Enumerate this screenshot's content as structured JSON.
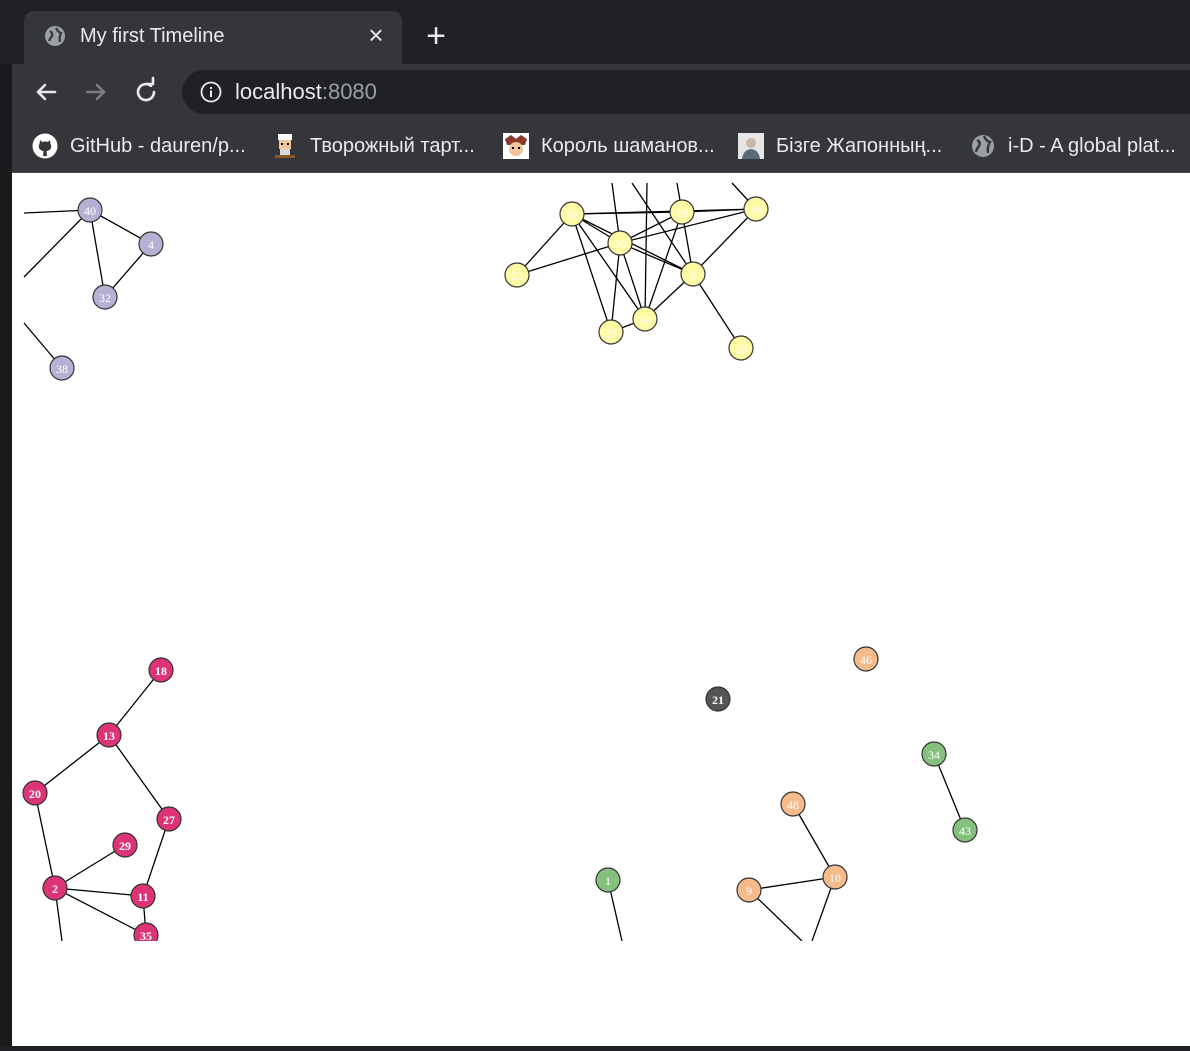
{
  "window": {
    "tab_title": "My first Timeline",
    "tab_icon": "globe-icon",
    "close_icon": "close-icon",
    "new_tab_icon": "plus-icon"
  },
  "toolbar": {
    "back_icon": "arrow-left-icon",
    "forward_icon": "arrow-right-icon",
    "reload_icon": "reload-icon",
    "site_info_icon": "info-icon",
    "url_host": "localhost",
    "url_port": ":8080"
  },
  "bookmarks": [
    {
      "label": "GitHub - dauren/p...",
      "icon": "github-icon"
    },
    {
      "label": "Творожный тарт...",
      "icon": "chef-avatar-icon"
    },
    {
      "label": "Король шаманов...",
      "icon": "anime-avatar-icon"
    },
    {
      "label": "Бізге Жапонның...",
      "icon": "person-photo-icon"
    },
    {
      "label": "i-D - A global plat...",
      "icon": "globe-icon"
    }
  ],
  "colors": {
    "purple": "#b8b0d4",
    "yellow": "#fffaa6",
    "pink": "#dd3477",
    "orange": "#f5bb8a",
    "green": "#86c07e",
    "gray": "#555555"
  },
  "graph": {
    "nodes": [
      {
        "id": "40",
        "group": "purple"
      },
      {
        "id": "4",
        "group": "purple"
      },
      {
        "id": "32",
        "group": "purple"
      },
      {
        "id": "38",
        "group": "purple"
      },
      {
        "id": "36",
        "group": "yellow"
      },
      {
        "id": "19",
        "group": "yellow"
      },
      {
        "id": "39",
        "group": "yellow"
      },
      {
        "id": "26",
        "group": "yellow"
      },
      {
        "id": "23",
        "group": "yellow"
      },
      {
        "id": "6",
        "group": "yellow"
      },
      {
        "id": "44",
        "group": "yellow"
      },
      {
        "id": "25",
        "group": "yellow"
      },
      {
        "id": "28",
        "group": "yellow"
      },
      {
        "id": "18",
        "group": "pink"
      },
      {
        "id": "13",
        "group": "pink"
      },
      {
        "id": "20",
        "group": "pink"
      },
      {
        "id": "27",
        "group": "pink"
      },
      {
        "id": "29",
        "group": "pink"
      },
      {
        "id": "2",
        "group": "pink"
      },
      {
        "id": "11",
        "group": "pink"
      },
      {
        "id": "35",
        "group": "pink"
      },
      {
        "id": "21",
        "group": "gray"
      },
      {
        "id": "46",
        "group": "orange"
      },
      {
        "id": "34",
        "group": "green"
      },
      {
        "id": "43",
        "group": "green"
      },
      {
        "id": "48",
        "group": "orange"
      },
      {
        "id": "10",
        "group": "orange"
      },
      {
        "id": "9",
        "group": "orange"
      },
      {
        "id": "1",
        "group": "green"
      }
    ],
    "links": [
      [
        "40",
        "4"
      ],
      [
        "40",
        "32"
      ],
      [
        "4",
        "32"
      ],
      [
        "36",
        "19"
      ],
      [
        "36",
        "39"
      ],
      [
        "36",
        "26"
      ],
      [
        "36",
        "23"
      ],
      [
        "36",
        "6"
      ],
      [
        "36",
        "44"
      ],
      [
        "19",
        "39"
      ],
      [
        "19",
        "26"
      ],
      [
        "19",
        "6"
      ],
      [
        "19",
        "44"
      ],
      [
        "26",
        "39"
      ],
      [
        "26",
        "23"
      ],
      [
        "26",
        "6"
      ],
      [
        "26",
        "44"
      ],
      [
        "26",
        "25"
      ],
      [
        "39",
        "6"
      ],
      [
        "6",
        "44"
      ],
      [
        "6",
        "28"
      ],
      [
        "44",
        "25"
      ],
      [
        "36",
        "25"
      ],
      [
        "18",
        "13"
      ],
      [
        "13",
        "20"
      ],
      [
        "13",
        "27"
      ],
      [
        "20",
        "2"
      ],
      [
        "2",
        "29"
      ],
      [
        "2",
        "11"
      ],
      [
        "2",
        "35"
      ],
      [
        "27",
        "11"
      ],
      [
        "11",
        "35"
      ],
      [
        "34",
        "43"
      ],
      [
        "48",
        "10"
      ],
      [
        "10",
        "9"
      ]
    ]
  }
}
